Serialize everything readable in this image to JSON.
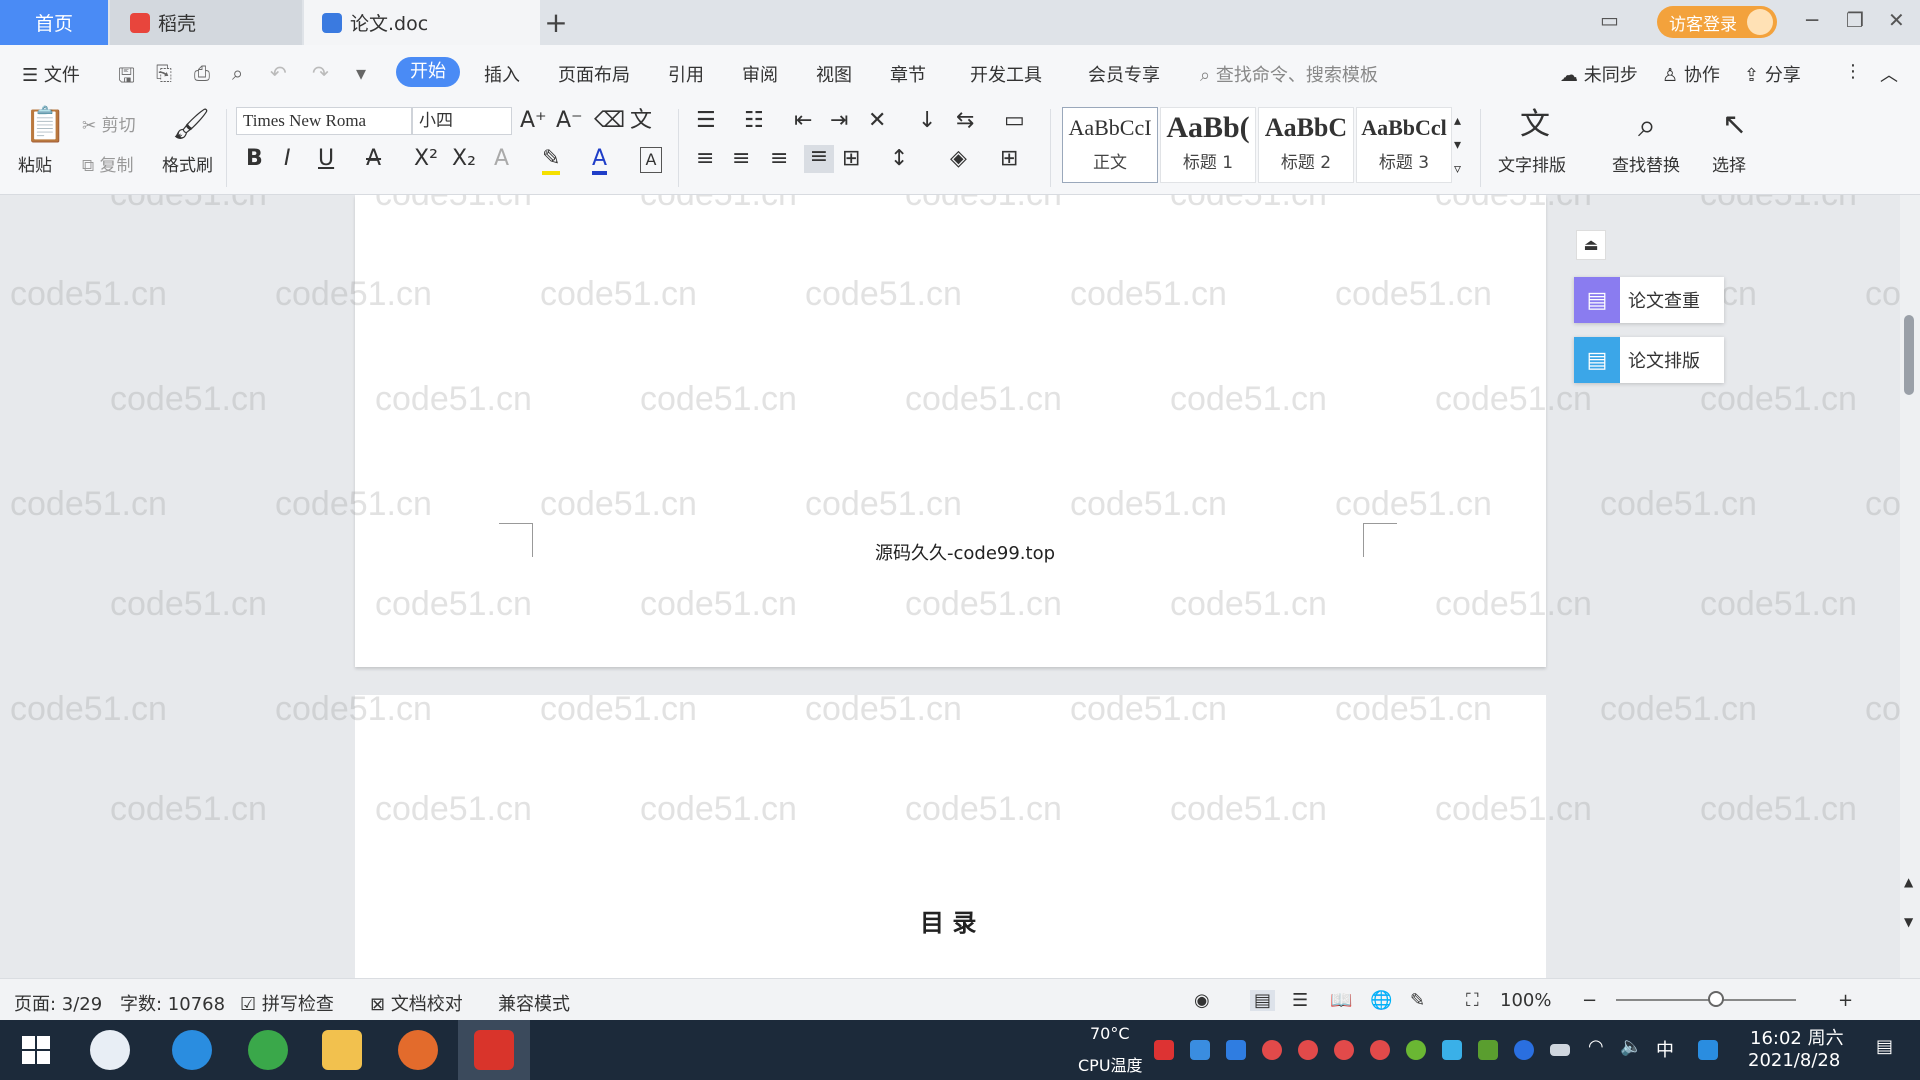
{
  "tabs": {
    "home": "首页",
    "daoke": "稻壳",
    "doc": "论文.doc",
    "add": "+"
  },
  "titlebar": {
    "guest_login": "访客登录"
  },
  "menu": {
    "file": "文件",
    "items": [
      "开始",
      "插入",
      "页面布局",
      "引用",
      "审阅",
      "视图",
      "章节",
      "开发工具",
      "会员专享"
    ],
    "search_placeholder": "查找命令、搜索模板",
    "sync": "未同步",
    "collab": "协作",
    "share": "分享"
  },
  "ribbon": {
    "paste": "粘贴",
    "cut": "剪切",
    "copy": "复制",
    "format_painter": "格式刷",
    "font_name": "Times New Roma",
    "font_size": "小四",
    "styles": [
      {
        "sample": "AaBbCcI",
        "label": "正文"
      },
      {
        "sample": "AaBb(",
        "label": "标题 1"
      },
      {
        "sample": "AaBbC",
        "label": "标题 2"
      },
      {
        "sample": "AaBbCcl",
        "label": "标题 3"
      }
    ],
    "text_layout": "文字排版",
    "find_replace": "查找替换",
    "select": "选择"
  },
  "side_panel": {
    "check": "论文查重",
    "format": "论文排版"
  },
  "document": {
    "footer_text": "源码久久-code99.top",
    "toc_title": "目 录",
    "watermark": "code51.cn"
  },
  "status": {
    "page": "页面: 3/29",
    "words": "字数: 10768",
    "spell": "拼写检查",
    "proof": "文档校对",
    "compat": "兼容模式",
    "zoom": "100%"
  },
  "taskbar": {
    "cpu_temp": "70°C",
    "cpu_label": "CPU温度",
    "ime": "中",
    "time": "16:02 周六",
    "date": "2021/8/28"
  },
  "colors": {
    "accent": "#4a8bf5",
    "guest": "#f3a23c",
    "taskbar": "#1c2a3a"
  }
}
